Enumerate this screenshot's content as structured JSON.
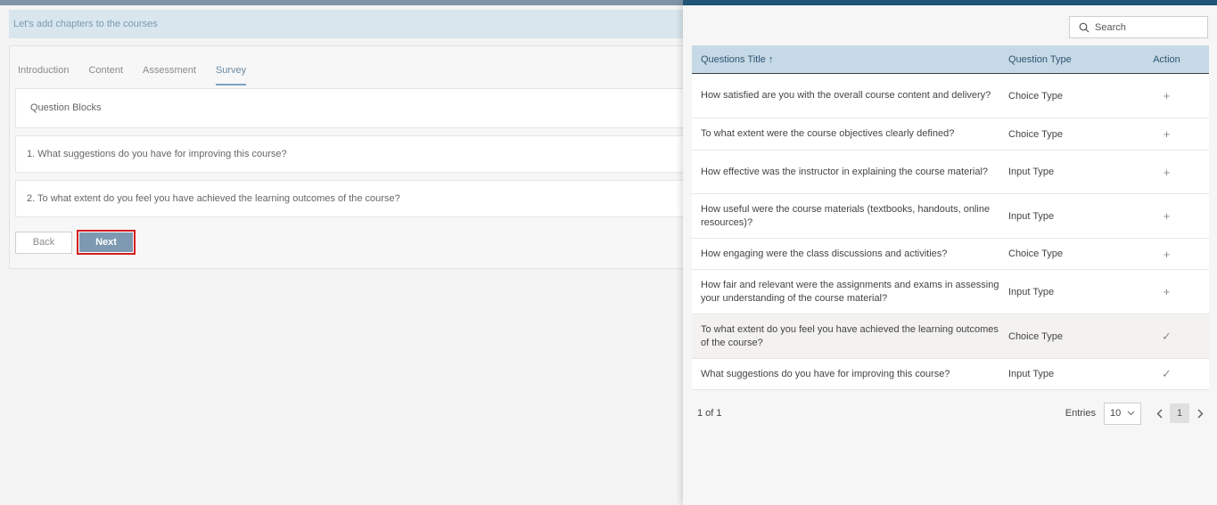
{
  "banner": {
    "text": "Let's add chapters to the courses"
  },
  "tabs": [
    {
      "label": "Introduction"
    },
    {
      "label": "Content"
    },
    {
      "label": "Assessment"
    },
    {
      "label": "Survey"
    }
  ],
  "blocks": {
    "header": "Question Blocks",
    "questions": [
      "1. What suggestions do you have for improving this course?",
      "2. To what extent do you feel you have achieved the learning outcomes of the course?"
    ]
  },
  "buttons": {
    "back": "Back",
    "next": "Next"
  },
  "colors": {
    "accent": "#7d99b1",
    "highlight_border": "#d51d1d",
    "drawer_top": "#1f5476",
    "table_header": "#c6d9e6"
  },
  "drawer": {
    "search": {
      "placeholder": "Search",
      "icon": "search-icon"
    },
    "table": {
      "headers": {
        "title": "Questions Title ↑",
        "type": "Question Type",
        "action": "Action"
      },
      "rows": [
        {
          "title": "How satisfied are you with the overall course content and delivery?",
          "type": "Choice Type",
          "action": "+"
        },
        {
          "title": "To what extent were the course objectives clearly defined?",
          "type": "Choice Type",
          "action": "+"
        },
        {
          "title": "How effective was the instructor in explaining the course material?",
          "type": "Input Type",
          "action": "+"
        },
        {
          "title": "How useful were the course materials (textbooks, handouts, online resources)?",
          "type": "Input Type",
          "action": "+"
        },
        {
          "title": "How engaging were the class discussions and activities?",
          "type": "Choice Type",
          "action": "+"
        },
        {
          "title": "How fair and relevant were the assignments and exams in assessing your understanding of the course material?",
          "type": "Input Type",
          "action": "+"
        },
        {
          "title": "To what extent do you feel you have achieved the learning outcomes of the course?",
          "type": "Choice Type",
          "action": "✓"
        },
        {
          "title": "What suggestions do you have for improving this course?",
          "type": "Input Type",
          "action": "✓"
        }
      ]
    },
    "footer": {
      "page_info": "1 of 1",
      "entries_label": "Entries",
      "entries_value": "10",
      "current_page": "1"
    }
  }
}
